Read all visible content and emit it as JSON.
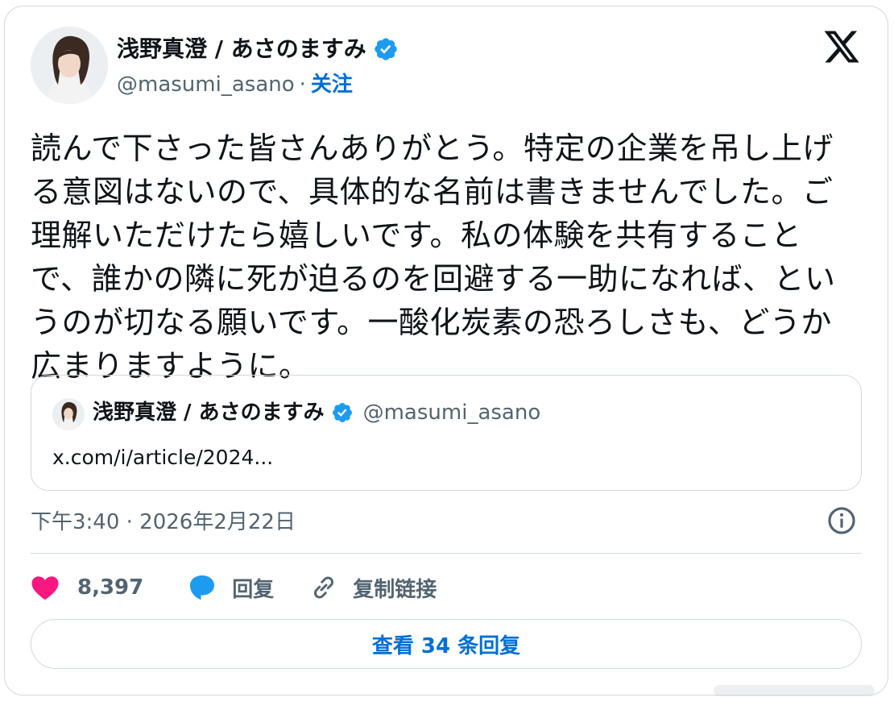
{
  "tweet": {
    "author_name": "浅野真澄 / あさのますみ",
    "handle": "@masumi_asano",
    "separator": "·",
    "follow_label": "关注",
    "text": "読んで下さった皆さんありがとう。特定の企業を吊し上げる意図はないので、具体的な名前は書きませんでした。ご理解いただけたら嬉しいです。私の体験を共有することで、誰かの隣に死が迫るのを回避する一助になれば、というのが切なる願いです。一酸化炭素の恐ろしさも、どうか広まりますように。",
    "timestamp": "下午3:40 · 2026年2月22日"
  },
  "quoted": {
    "author_name": "浅野真澄 / あさのますみ",
    "handle": "@masumi_asano",
    "link_text": "x.com/i/article/2024..."
  },
  "actions": {
    "like_count": "8,397",
    "reply_label": "回复",
    "copy_link_label": "复制链接"
  },
  "view_replies_label": "查看 34 条回复",
  "icons": {
    "brand": "x-logo-icon",
    "verified": "verified-badge-icon",
    "info": "info-icon",
    "like": "heart-icon",
    "reply": "speech-bubble-icon",
    "copy": "link-icon"
  },
  "colors": {
    "link_blue": "#006fd6",
    "verified_blue": "#1d9bf0",
    "like_pink": "#f91880",
    "muted": "#536471",
    "border": "#cfd9de"
  }
}
